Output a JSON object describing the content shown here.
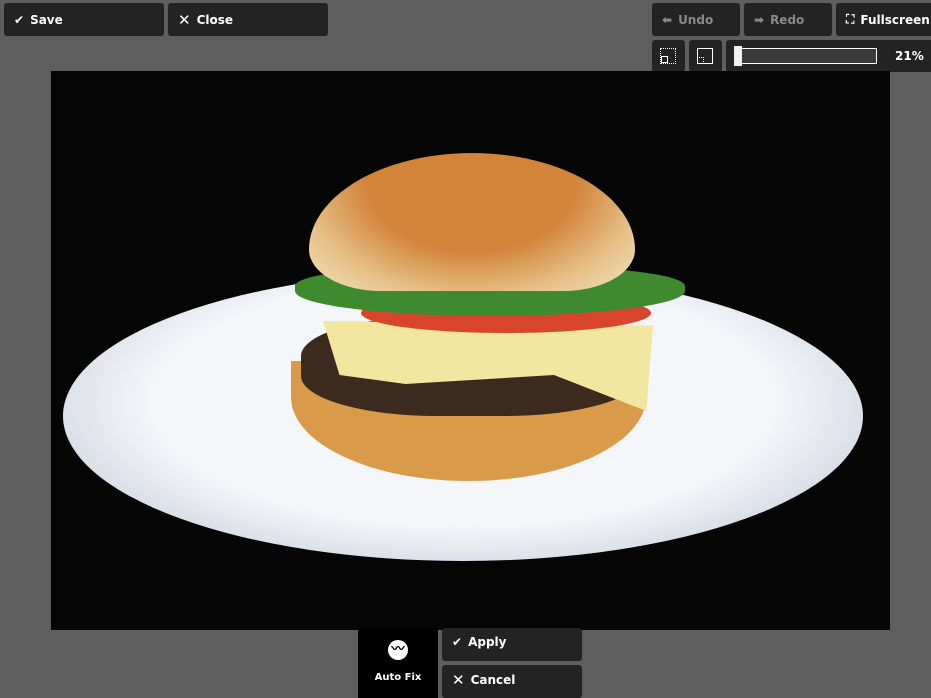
{
  "toolbar": {
    "save": "Save",
    "close": "Close",
    "undo": "Undo",
    "redo": "Redo",
    "fullscreen": "Fullscreen"
  },
  "zoom": {
    "percent_label": "21%",
    "value_percent": 21
  },
  "bottom": {
    "auto_fix": "Auto Fix",
    "apply": "Apply",
    "cancel": "Cancel"
  },
  "icons": {
    "save": "check-icon",
    "close": "x-icon",
    "undo": "arrow-left-icon",
    "redo": "arrow-right-icon",
    "fullscreen": "expand-icon",
    "zoom_in": "zoom-fit-icon",
    "zoom_out": "zoom-shrink-icon",
    "auto_fix": "auto-fix-icon"
  }
}
